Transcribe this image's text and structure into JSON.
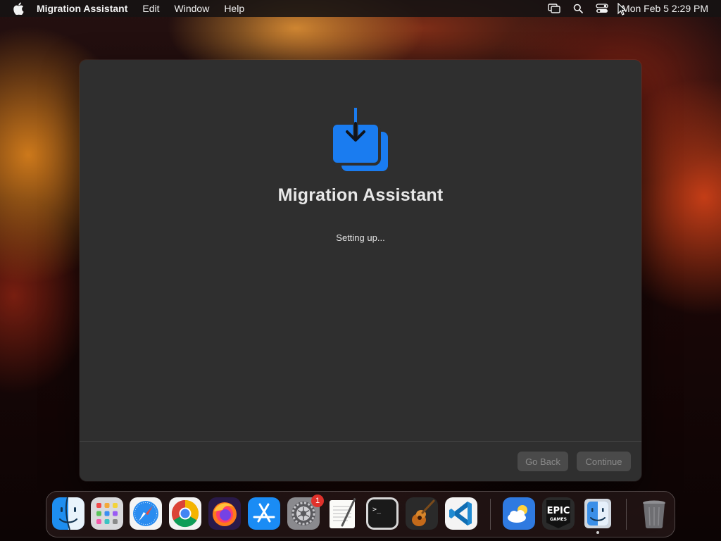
{
  "menubar": {
    "app_name": "Migration Assistant",
    "menus": [
      "Edit",
      "Window",
      "Help"
    ],
    "clock": "Mon Feb 5  2:29 PM",
    "status_icons": [
      "screen-mirroring-icon",
      "search-icon",
      "control-center-icon"
    ]
  },
  "window": {
    "title": "Migration Assistant",
    "status": "Setting up...",
    "icon": "migration-download-icon",
    "accent_color": "#1a7cf0",
    "buttons": {
      "back": "Go Back",
      "continue": "Continue"
    }
  },
  "dock": {
    "apps": [
      {
        "name": "Finder",
        "icon": "finder-icon"
      },
      {
        "name": "Launchpad",
        "icon": "launchpad-icon"
      },
      {
        "name": "Safari",
        "icon": "safari-icon"
      },
      {
        "name": "Chrome",
        "icon": "chrome-icon"
      },
      {
        "name": "Firefox",
        "icon": "firefox-icon"
      },
      {
        "name": "App Store",
        "icon": "app-store-icon"
      },
      {
        "name": "System Settings",
        "icon": "settings-icon",
        "badge": "1"
      },
      {
        "name": "TextEdit",
        "icon": "textedit-icon"
      },
      {
        "name": "Terminal",
        "icon": "terminal-icon",
        "text": ">_"
      },
      {
        "name": "GarageBand",
        "icon": "garageband-icon"
      },
      {
        "name": "Visual Studio Code",
        "icon": "vscode-icon"
      },
      {
        "name": "Weather",
        "icon": "weather-icon"
      },
      {
        "name": "Epic Games",
        "icon": "epic-games-icon",
        "text_line1": "EPIC",
        "text_line2": "GAMES"
      },
      {
        "name": "Migration Assistant",
        "icon": "migration-finder-icon"
      },
      {
        "name": "Trash",
        "icon": "trash-icon"
      }
    ]
  }
}
